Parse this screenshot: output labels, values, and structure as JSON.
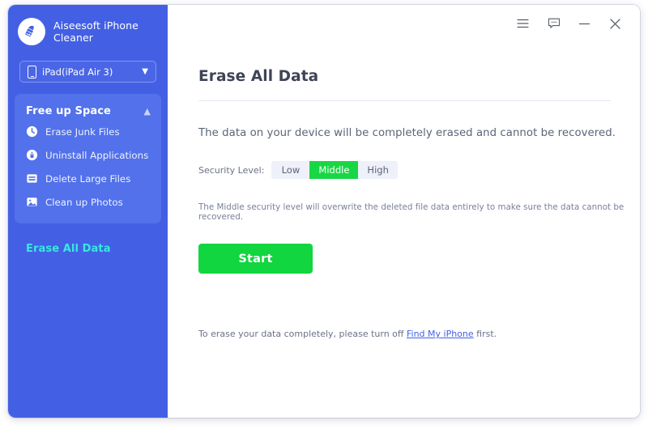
{
  "app": {
    "name": "Aiseesoft iPhone Cleaner",
    "logo_icon": "broom-logo-icon"
  },
  "sidebar": {
    "device_selector": {
      "label": "iPad(iPad Air 3)",
      "device_icon": "tablet-icon",
      "chevron_icon": "chevron-down-icon"
    },
    "group": {
      "title": "Free up Space",
      "chevron_icon": "chevron-up-icon",
      "items": [
        {
          "label": "Erase Junk Files",
          "icon": "clock-icon"
        },
        {
          "label": "Uninstall Applications",
          "icon": "rocket-circle-icon"
        },
        {
          "label": "Delete Large Files",
          "icon": "document-lines-icon"
        },
        {
          "label": "Clean up Photos",
          "icon": "photo-icon"
        }
      ]
    },
    "erase_all_data": {
      "label": "Erase All Data",
      "active": true,
      "active_color": "#37e8e0"
    }
  },
  "titlebar": {
    "buttons": [
      {
        "name": "menu",
        "icon": "hamburger-menu-icon"
      },
      {
        "name": "feedback",
        "icon": "chat-bubble-icon"
      },
      {
        "name": "minimize",
        "icon": "minimize-icon"
      },
      {
        "name": "close",
        "icon": "close-icon"
      }
    ]
  },
  "main": {
    "title": "Erase All Data",
    "lead": "The data on your device will be completely erased and cannot be recovered.",
    "security": {
      "label": "Security Level:",
      "options": [
        "Low",
        "Middle",
        "High"
      ],
      "selected": "Middle",
      "selected_color": "#18d744"
    },
    "note": "The Middle security level will overwrite the deleted file data entirely to make sure the data cannot be recovered.",
    "start_button": {
      "label": "Start",
      "color": "#11d63f"
    },
    "footer": {
      "prefix": "To erase your data completely, please turn off ",
      "link": "Find My iPhone",
      "suffix": " first."
    }
  },
  "colors": {
    "sidebar_bg": "#4360e4",
    "sidebar_panel": "#5271ea",
    "accent_green": "#18d744",
    "accent_cyan": "#37e8e0"
  }
}
